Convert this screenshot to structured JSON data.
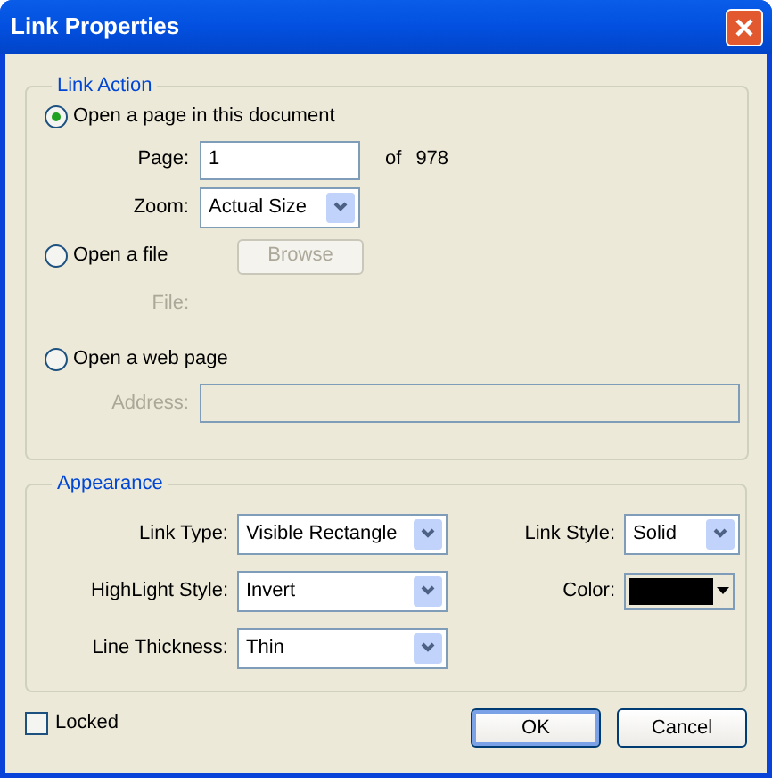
{
  "window": {
    "title": "Link Properties"
  },
  "link_action": {
    "legend": "Link Action",
    "options": [
      {
        "kind": "page",
        "label": "Open a page in this document",
        "selected": true,
        "page_label": "Page:",
        "page_value": "1",
        "of_label": "of",
        "page_total": "978",
        "zoom_label": "Zoom:",
        "zoom_value": "Actual Size"
      },
      {
        "kind": "file",
        "label": "Open a file",
        "selected": false,
        "browse_label": "Browse",
        "browse_disabled": true,
        "file_label": "File:",
        "fields_disabled": true
      },
      {
        "kind": "web",
        "label": "Open a web page",
        "selected": false,
        "address_label": "Address:",
        "fields_disabled": true
      }
    ]
  },
  "appearance": {
    "legend": "Appearance",
    "link_type": {
      "label": "Link Type:",
      "value": "Visible Rectangle"
    },
    "link_style": {
      "label": "Link Style:",
      "value": "Solid"
    },
    "highlight_style": {
      "label": "HighLight Style:",
      "value": "Invert"
    },
    "color": {
      "label": "Color:",
      "color": "#000000"
    },
    "line_thickness": {
      "label": "Line Thickness:",
      "value": "Thin"
    }
  },
  "locked": {
    "label": "Locked",
    "checked": false
  },
  "buttons": [
    {
      "label": "OK",
      "default": true
    },
    {
      "label": "Cancel",
      "default": false
    }
  ]
}
